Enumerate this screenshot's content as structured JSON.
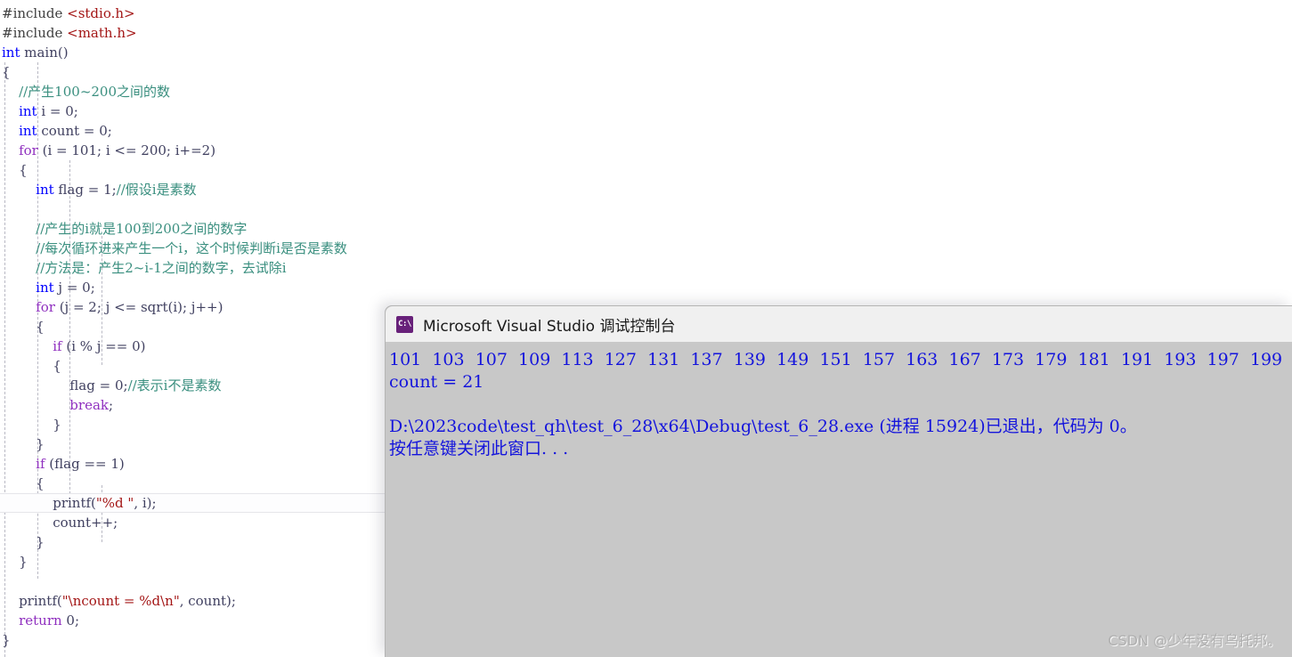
{
  "editor": {
    "name": "visual-studio-code-editor",
    "language": "C",
    "lines": [
      {
        "indent": 0,
        "tokens": [
          {
            "t": "#include ",
            "c": "pre"
          },
          {
            "t": "<stdio.h>",
            "c": "hdr"
          }
        ]
      },
      {
        "indent": 0,
        "tokens": [
          {
            "t": "#include ",
            "c": "pre"
          },
          {
            "t": "<math.h>",
            "c": "hdr"
          }
        ]
      },
      {
        "indent": 0,
        "tokens": [
          {
            "t": "int",
            "c": "kw"
          },
          {
            "t": " main()",
            "c": "id"
          }
        ]
      },
      {
        "indent": 0,
        "tokens": [
          {
            "t": "{",
            "c": "id"
          }
        ]
      },
      {
        "indent": 1,
        "tokens": [
          {
            "t": "//产生100~200之间的数",
            "c": "cmt"
          }
        ]
      },
      {
        "indent": 1,
        "tokens": [
          {
            "t": "int",
            "c": "kw"
          },
          {
            "t": " i = 0;",
            "c": "id"
          }
        ]
      },
      {
        "indent": 1,
        "tokens": [
          {
            "t": "int",
            "c": "kw"
          },
          {
            "t": " count = 0;",
            "c": "id"
          }
        ]
      },
      {
        "indent": 1,
        "tokens": [
          {
            "t": "for",
            "c": "kw2"
          },
          {
            "t": " (i = 101; i <= 200; i+=2)",
            "c": "id"
          }
        ]
      },
      {
        "indent": 1,
        "tokens": [
          {
            "t": "{",
            "c": "id"
          }
        ]
      },
      {
        "indent": 2,
        "tokens": [
          {
            "t": "int",
            "c": "kw"
          },
          {
            "t": " flag = 1;",
            "c": "id"
          },
          {
            "t": "//假设i是素数",
            "c": "cmt"
          }
        ]
      },
      {
        "indent": 2,
        "tokens": [
          {
            "t": "",
            "c": "id"
          }
        ]
      },
      {
        "indent": 2,
        "tokens": [
          {
            "t": "//产生的i就是100到200之间的数字",
            "c": "cmt"
          }
        ]
      },
      {
        "indent": 2,
        "tokens": [
          {
            "t": "//每次循环进来产生一个i，这个时候判断i是否是素数",
            "c": "cmt"
          }
        ]
      },
      {
        "indent": 2,
        "tokens": [
          {
            "t": "//方法是：产生2~i-1之间的数字，去试除i",
            "c": "cmt"
          }
        ]
      },
      {
        "indent": 2,
        "tokens": [
          {
            "t": "int",
            "c": "kw"
          },
          {
            "t": " j = 0;",
            "c": "id"
          }
        ]
      },
      {
        "indent": 2,
        "tokens": [
          {
            "t": "for",
            "c": "kw2"
          },
          {
            "t": " (j = 2; j <= sqrt(i); j++)",
            "c": "id"
          }
        ]
      },
      {
        "indent": 2,
        "tokens": [
          {
            "t": "{",
            "c": "id"
          }
        ]
      },
      {
        "indent": 3,
        "tokens": [
          {
            "t": "if",
            "c": "kw2"
          },
          {
            "t": " (i % j == 0)",
            "c": "id"
          }
        ]
      },
      {
        "indent": 3,
        "tokens": [
          {
            "t": "{",
            "c": "id"
          }
        ]
      },
      {
        "indent": 4,
        "tokens": [
          {
            "t": "flag = 0;",
            "c": "id"
          },
          {
            "t": "//表示i不是素数",
            "c": "cmt"
          }
        ]
      },
      {
        "indent": 4,
        "tokens": [
          {
            "t": "break",
            "c": "kw2"
          },
          {
            "t": ";",
            "c": "id"
          }
        ]
      },
      {
        "indent": 3,
        "tokens": [
          {
            "t": "}",
            "c": "id"
          }
        ]
      },
      {
        "indent": 2,
        "tokens": [
          {
            "t": "}",
            "c": "id"
          }
        ]
      },
      {
        "indent": 2,
        "tokens": [
          {
            "t": "if",
            "c": "kw2"
          },
          {
            "t": " (flag == 1)",
            "c": "id"
          }
        ]
      },
      {
        "indent": 2,
        "tokens": [
          {
            "t": "{",
            "c": "id"
          }
        ]
      },
      {
        "indent": 3,
        "current": true,
        "tokens": [
          {
            "t": "printf(",
            "c": "id"
          },
          {
            "t": "\"%d \"",
            "c": "str"
          },
          {
            "t": ", i);",
            "c": "id"
          }
        ]
      },
      {
        "indent": 3,
        "tokens": [
          {
            "t": "count++;",
            "c": "id"
          }
        ]
      },
      {
        "indent": 2,
        "tokens": [
          {
            "t": "}",
            "c": "id"
          }
        ]
      },
      {
        "indent": 1,
        "tokens": [
          {
            "t": "}",
            "c": "id"
          }
        ]
      },
      {
        "indent": 1,
        "tokens": [
          {
            "t": "",
            "c": "id"
          }
        ]
      },
      {
        "indent": 1,
        "tokens": [
          {
            "t": "printf(",
            "c": "id"
          },
          {
            "t": "\"\\ncount = %d\\n\"",
            "c": "str"
          },
          {
            "t": ", count);",
            "c": "id"
          }
        ]
      },
      {
        "indent": 1,
        "tokens": [
          {
            "t": "return",
            "c": "kw2"
          },
          {
            "t": " 0;",
            "c": "id"
          }
        ]
      },
      {
        "indent": 0,
        "tokens": [
          {
            "t": "}",
            "c": "id"
          }
        ]
      }
    ]
  },
  "console": {
    "title": "Microsoft Visual Studio 调试控制台",
    "icon": "cmd-prompt-icon",
    "icon_glyph": "C:\\",
    "output": [
      {
        "text": "101  103  107  109  113  127  131  137  139  149  151  157  163  167  173  179  181  191  193  197  199"
      },
      {
        "text": "count = 21"
      },
      {
        "text": ""
      },
      {
        "text": "D:\\2023code\\test_qh\\test_6_28\\x64\\Debug\\test_6_28.exe (进程 15924)已退出，代码为 0。"
      },
      {
        "text": "按任意键关闭此窗口. . ."
      }
    ],
    "primes": [
      101,
      103,
      107,
      109,
      113,
      127,
      131,
      137,
      139,
      149,
      151,
      157,
      163,
      167,
      173,
      179,
      181,
      191,
      193,
      197,
      199
    ],
    "count": 21,
    "exe_path": "D:\\2023code\\test_qh\\test_6_28\\x64\\Debug\\test_6_28.exe",
    "process_id": "15924",
    "exit_code": "0",
    "text_color": "#1414dc",
    "background_color": "#c8c8c8",
    "titlebar_color": "#f0f0f0"
  },
  "watermark": {
    "text": "CSDN @少年没有乌托邦。"
  }
}
